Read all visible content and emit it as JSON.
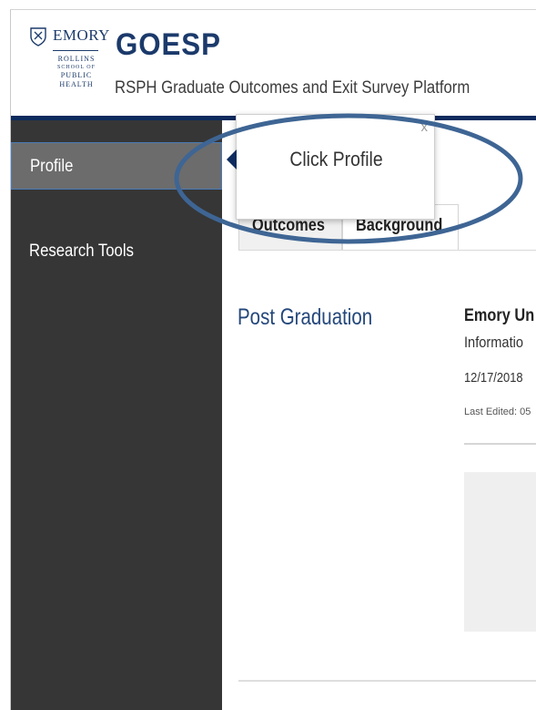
{
  "header": {
    "logo": {
      "wordmark": "EMORY",
      "line1": "ROLLINS",
      "line2": "SCHOOL OF",
      "line3": "PUBLIC",
      "line4": "HEALTH"
    },
    "title": "GOESP",
    "subtitle": "RSPH Graduate Outcomes and Exit Survey Platform"
  },
  "sidebar": {
    "items": [
      {
        "label": "Profile",
        "active": true
      },
      {
        "label": "Research Tools",
        "active": false
      }
    ]
  },
  "main": {
    "tabs": [
      {
        "label": "Outcomes"
      },
      {
        "label": "Background"
      }
    ],
    "section_label": "Post Graduation",
    "card": {
      "title": "Emory Un",
      "info": "Informatio",
      "date": "12/17/2018",
      "last_edited": "Last Edited: 05"
    }
  },
  "tooltip": {
    "text": "Click Profile",
    "close_label": "x"
  },
  "colors": {
    "brand_navy": "#0d2b5e",
    "sidebar_bg": "#363636",
    "active_item": "#6c6c6c",
    "highlight_ellipse": "#3e6594"
  },
  "icons": {
    "logo": "emory-shield-icon",
    "tooltip_close": "close-icon"
  }
}
